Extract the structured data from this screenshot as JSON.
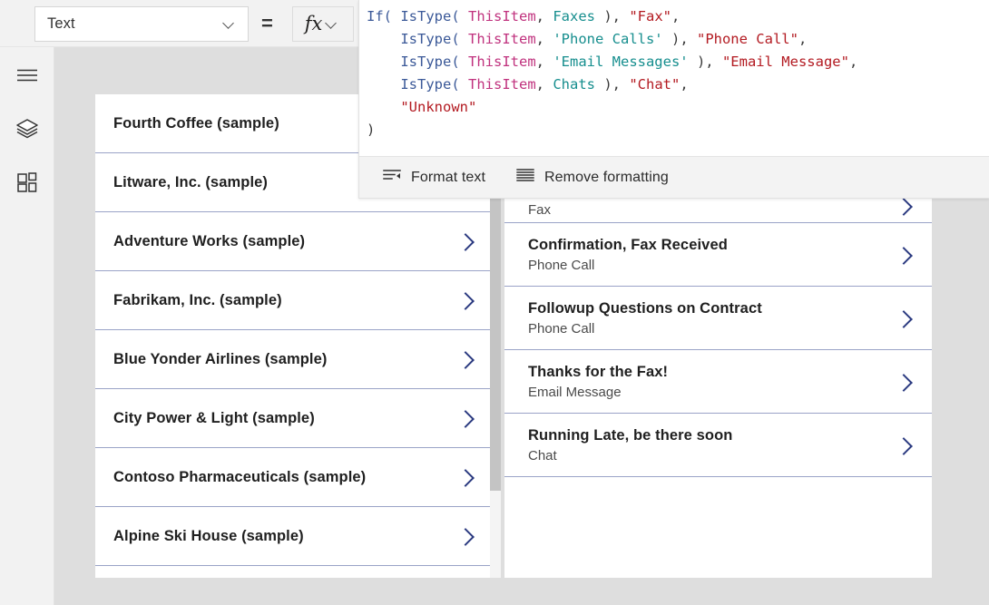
{
  "propertybar": {
    "property_selected": "Text",
    "property_options": [
      "Text"
    ],
    "equals_sign": "=",
    "fx_label": "fx",
    "dropdown_icon": "chevron-down-icon",
    "fx_dropdown_icon": "chevron-down-icon"
  },
  "rail": {
    "items": [
      {
        "id": "menu",
        "icon": "hamburger-menu-icon",
        "label": "Menu"
      },
      {
        "id": "tree-view",
        "icon": "layers-icon",
        "label": "Tree view"
      },
      {
        "id": "insert",
        "icon": "insert-components-icon",
        "label": "Insert"
      }
    ]
  },
  "formula_bar": {
    "lines": [
      [
        {
          "t": "If(",
          "c": "fn"
        },
        {
          "t": " ",
          "c": "pun"
        },
        {
          "t": "IsType(",
          "c": "fn"
        },
        {
          "t": " ",
          "c": "pun"
        },
        {
          "t": "ThisItem",
          "c": "var"
        },
        {
          "t": ", ",
          "c": "pun"
        },
        {
          "t": "Faxes",
          "c": "tbl"
        },
        {
          "t": " ), ",
          "c": "pun"
        },
        {
          "t": "\"Fax\"",
          "c": "str"
        },
        {
          "t": ",",
          "c": "pun"
        }
      ],
      [
        {
          "t": "    ",
          "c": "pun"
        },
        {
          "t": "IsType(",
          "c": "fn"
        },
        {
          "t": " ",
          "c": "pun"
        },
        {
          "t": "ThisItem",
          "c": "var"
        },
        {
          "t": ", ",
          "c": "pun"
        },
        {
          "t": "'Phone Calls'",
          "c": "tbl"
        },
        {
          "t": " ), ",
          "c": "pun"
        },
        {
          "t": "\"Phone Call\"",
          "c": "str"
        },
        {
          "t": ",",
          "c": "pun"
        }
      ],
      [
        {
          "t": "    ",
          "c": "pun"
        },
        {
          "t": "IsType(",
          "c": "fn"
        },
        {
          "t": " ",
          "c": "pun"
        },
        {
          "t": "ThisItem",
          "c": "var"
        },
        {
          "t": ", ",
          "c": "pun"
        },
        {
          "t": "'Email Messages'",
          "c": "tbl"
        },
        {
          "t": " ), ",
          "c": "pun"
        },
        {
          "t": "\"Email Message\"",
          "c": "str"
        },
        {
          "t": ",",
          "c": "pun"
        }
      ],
      [
        {
          "t": "    ",
          "c": "pun"
        },
        {
          "t": "IsType(",
          "c": "fn"
        },
        {
          "t": " ",
          "c": "pun"
        },
        {
          "t": "ThisItem",
          "c": "var"
        },
        {
          "t": ", ",
          "c": "pun"
        },
        {
          "t": "Chats",
          "c": "tbl"
        },
        {
          "t": " ), ",
          "c": "pun"
        },
        {
          "t": "\"Chat\"",
          "c": "str"
        },
        {
          "t": ",",
          "c": "pun"
        }
      ],
      [
        {
          "t": "    ",
          "c": "pun"
        },
        {
          "t": "\"Unknown\"",
          "c": "str"
        }
      ],
      [
        {
          "t": ")",
          "c": "pun"
        }
      ]
    ],
    "plain_text": "If( IsType( ThisItem, Faxes ), \"Fax\",\n    IsType( ThisItem, 'Phone Calls' ), \"Phone Call\",\n    IsType( ThisItem, 'Email Messages' ), \"Email Message\",\n    IsType( ThisItem, Chats ), \"Chat\",\n    \"Unknown\"\n)",
    "toolbar": [
      {
        "id": "format-text",
        "icon": "format-text-icon",
        "label": "Format text"
      },
      {
        "id": "remove-formatting",
        "icon": "remove-formatting-icon",
        "label": "Remove formatting"
      }
    ]
  },
  "gallery_left": {
    "rows": [
      {
        "title": "Fourth Coffee (sample)",
        "chevron": false
      },
      {
        "title": "Litware, Inc. (sample)",
        "chevron": false
      },
      {
        "title": "Adventure Works (sample)",
        "chevron": true
      },
      {
        "title": "Fabrikam, Inc. (sample)",
        "chevron": true
      },
      {
        "title": "Blue Yonder Airlines (sample)",
        "chevron": true
      },
      {
        "title": "City Power & Light (sample)",
        "chevron": true
      },
      {
        "title": "Contoso Pharmaceuticals (sample)",
        "chevron": true
      },
      {
        "title": "Alpine Ski House (sample)",
        "chevron": true
      }
    ],
    "scroll_down_icon": "scroll-down-arrow-icon"
  },
  "gallery_right": {
    "rows": [
      {
        "title": "",
        "subtitle": "Fax",
        "partial": true,
        "chevron": true
      },
      {
        "title": "Confirmation, Fax Received",
        "subtitle": "Phone Call",
        "partial": false,
        "chevron": true
      },
      {
        "title": "Followup Questions on Contract",
        "subtitle": "Phone Call",
        "partial": false,
        "chevron": true
      },
      {
        "title": "Thanks for the Fax!",
        "subtitle": "Email Message",
        "partial": false,
        "chevron": true
      },
      {
        "title": "Running Late, be there soon",
        "subtitle": "Chat",
        "partial": false,
        "chevron": true
      }
    ]
  },
  "colors": {
    "function": "#3b5998",
    "variable": "#c0327e",
    "table": "#168e8e",
    "string": "#b31a21",
    "row_divider": "#9aa3c7",
    "chevron": "#2b3a80",
    "canvas_bg": "#dedede",
    "toolbar_bg": "#f2f2f2"
  }
}
